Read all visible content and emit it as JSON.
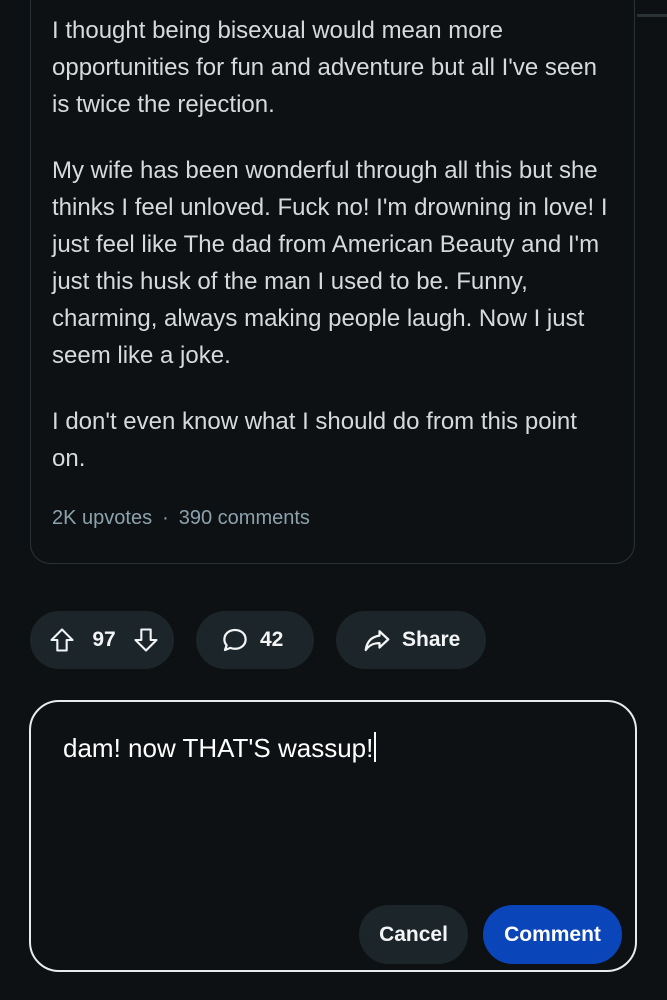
{
  "post": {
    "paragraphs": [
      "I thought being bisexual would mean more opportunities for fun and adventure but all I've seen is twice the rejection.",
      "My wife has been wonderful through all this but she thinks I feel unloved. Fuck no! I'm drowning in love! I just feel like The dad from American Beauty and I'm just this husk of the man I used to be. Funny, charming, always making people laugh. Now I just seem like a joke.",
      "I don't even know what I should do from this point on."
    ],
    "upvotes": "2K upvotes",
    "separator": "·",
    "comments": "390 comments"
  },
  "actions": {
    "vote_count": "97",
    "comment_count": "42",
    "share_label": "Share"
  },
  "reply": {
    "text": "dam! now THAT'S wassup!",
    "cancel_label": "Cancel",
    "submit_label": "Comment"
  },
  "colors": {
    "background": "#0e1113",
    "pill": "#1c2529",
    "accent": "#0b45ba"
  },
  "icons": [
    "upvote-icon",
    "downvote-icon",
    "comment-bubble-icon",
    "share-arrow-icon"
  ]
}
